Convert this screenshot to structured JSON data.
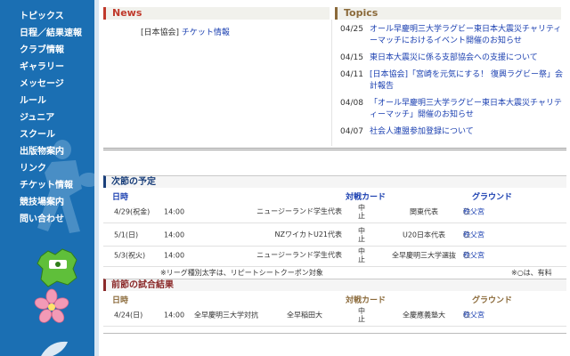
{
  "sidebar": {
    "items": [
      {
        "label": "トピックス"
      },
      {
        "label": "日程／結果速報"
      },
      {
        "label": "クラブ情報"
      },
      {
        "label": "ギャラリー"
      },
      {
        "label": "メッセージ"
      },
      {
        "label": "ルール"
      },
      {
        "label": "ジュニア"
      },
      {
        "label": "スクール"
      },
      {
        "label": "出版物案内"
      },
      {
        "label": "リンク"
      },
      {
        "label": "チケット情報"
      },
      {
        "label": "競技場案内"
      },
      {
        "label": "問い合わせ"
      }
    ]
  },
  "news": {
    "title": "News",
    "item": {
      "tag": "[日本協会]",
      "link": "チケット情報"
    }
  },
  "topics": {
    "title": "Topics",
    "items": [
      {
        "date": "04/25",
        "text": "オール早慶明三大学ラグビー東日本大震災チャリティーマッチにおけるイベント開催のお知らせ"
      },
      {
        "date": "04/15",
        "text": "東日本大震災に係る支部協会への支援について"
      },
      {
        "date": "04/11",
        "text": "[日本協会]「宮崎を元気にする！ 復興ラグビー祭」会計報告"
      },
      {
        "date": "04/08",
        "text": "「オール早慶明三大学ラグビー東日本大震災チャリティーマッチ」開催のお知らせ"
      },
      {
        "date": "04/07",
        "text": "社会人連盟参加登録について"
      }
    ]
  },
  "next_schedule": {
    "title": "次節の予定",
    "col_date": "日時",
    "col_match": "対戦カード",
    "col_ground": "グラウンド",
    "rows": [
      {
        "date": "4/29(祝金)",
        "time": "14:00",
        "team1": "ニュージーランド学生代表",
        "vs": "中止",
        "team2": "関東代表",
        "mark": "○",
        "ground": "秩父宮"
      },
      {
        "date": "5/1(日)",
        "time": "14:00",
        "team1": "NZワイカトU21代表",
        "vs": "中止",
        "team2": "U20日本代表",
        "mark": "○",
        "ground": "秩父宮"
      },
      {
        "date": "5/3(祝火)",
        "time": "14:00",
        "team1": "ニュージーランド学生代表",
        "vs": "中止",
        "team2": "全早慶明三大学選抜",
        "mark": "○",
        "ground": "秩父宮"
      }
    ],
    "note_left": "※リーグ種別太字は、リピートシートクーポン対象",
    "note_right": "※○は、有料"
  },
  "prev_results": {
    "title": "前節の試合結果",
    "col_date": "日時",
    "col_match": "対戦カード",
    "col_ground": "グラウンド",
    "rows": [
      {
        "date": "4/24(日)",
        "time": "14:00",
        "team1": "全早慶明三大学対抗",
        "team1b": "全早稲田大",
        "vs": "中止",
        "team2": "全慶應義塾大",
        "mark": "○",
        "ground": "秩父宮"
      }
    ]
  },
  "colors": {
    "sidebar": "#1b6fb3",
    "news_accent": "#c0392b",
    "topics_accent": "#8b6a3a",
    "link": "#1a3fb0",
    "next_accent": "#1a3f7a",
    "prev_accent": "#8b2a2a"
  },
  "icons": [
    "rugby-player-graphic",
    "map-badge-icon",
    "cherry-blossom-icon"
  ]
}
